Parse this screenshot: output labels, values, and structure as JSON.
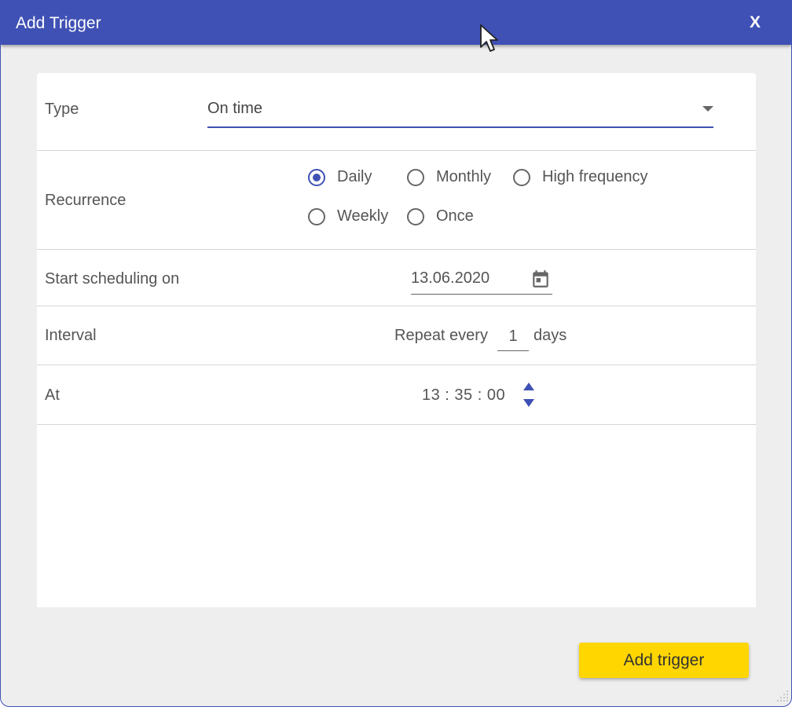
{
  "dialog": {
    "title": "Add Trigger",
    "close_label": "X"
  },
  "type": {
    "label": "Type",
    "value": "On time"
  },
  "recurrence": {
    "label": "Recurrence",
    "options": [
      {
        "label": "Daily",
        "checked": true
      },
      {
        "label": "Monthly",
        "checked": false
      },
      {
        "label": "High frequency",
        "checked": false
      },
      {
        "label": "Weekly",
        "checked": false
      },
      {
        "label": "Once",
        "checked": false
      }
    ]
  },
  "start": {
    "label": "Start scheduling on",
    "date": "13.06.2020"
  },
  "interval": {
    "label": "Interval",
    "prefix": "Repeat every",
    "value": "1",
    "suffix": "days"
  },
  "at": {
    "label": "At",
    "time": "13 : 35 : 00"
  },
  "footer": {
    "add_label": "Add trigger"
  },
  "colors": {
    "primary": "#3f51b5",
    "accent": "#ffd600",
    "background": "#eeeeee"
  }
}
